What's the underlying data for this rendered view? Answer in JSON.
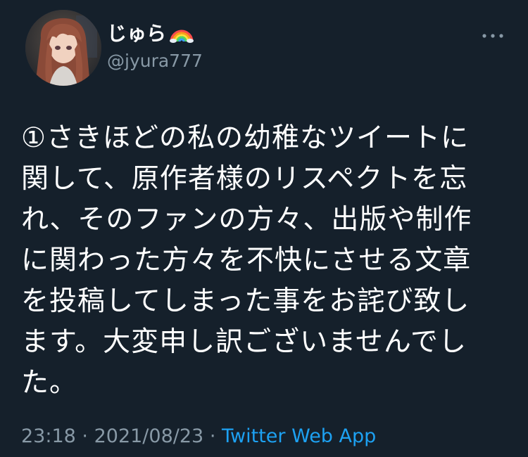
{
  "author": {
    "display_name": "じゅら",
    "name_emoji": "rainbow-icon",
    "handle": "@jyura777"
  },
  "menu": {
    "icon": "more-icon"
  },
  "tweet": {
    "lines": [
      "①さきほどの私の幼稚なツイートに",
      "関して、原作者様のリスペクトを忘",
      "れ、そのファンの方々、出版や制作",
      "に関わった方々を不快にさせる文章",
      "を投稿してしまった事をお詫び致し",
      "ます。大変申し訳ございませんでし",
      "た。"
    ]
  },
  "meta": {
    "time": "23:18",
    "separator": "·",
    "date": "2021/08/23",
    "source": "Twitter Web App"
  },
  "colors": {
    "background": "#15202b",
    "text": "#ffffff",
    "secondary": "#8899a6",
    "link": "#1da1f2"
  }
}
